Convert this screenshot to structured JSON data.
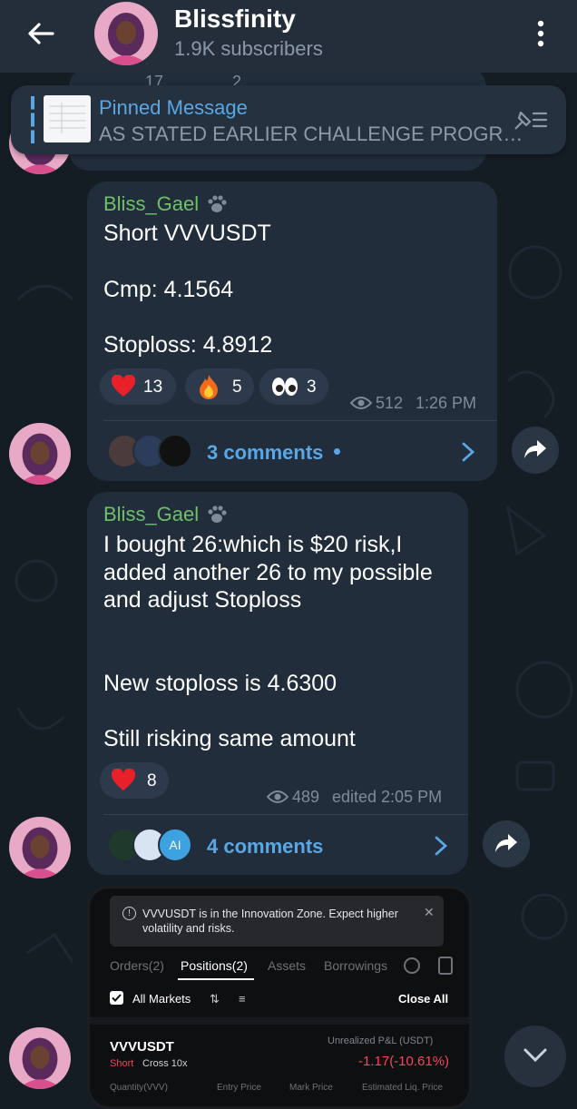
{
  "header": {
    "title": "Blissfinity",
    "subtitle": "1.9K subscribers"
  },
  "pinned": {
    "title": "Pinned Message",
    "text": "AS STATED EARLIER CHALLENGE PROGR…"
  },
  "above": {
    "reaction_counts": [
      "17",
      "2"
    ]
  },
  "messages": [
    {
      "author": "Bliss_Gael",
      "lines": [
        "Short VVVUSDT",
        "Cmp: 4.1564",
        "Stoploss: 4.8912"
      ],
      "reactions": [
        {
          "emoji": "heart",
          "count": "13"
        },
        {
          "emoji": "fire",
          "count": "5"
        },
        {
          "emoji": "eyes",
          "count": "3"
        }
      ],
      "views": "512",
      "time": "1:26 PM",
      "comments": "3 comments"
    },
    {
      "author": "Bliss_Gael",
      "lines": [
        "I bought 26:which is $20 risk,I",
        "added another 26 to my possible",
        "and adjust Stoploss",
        "New stoploss is 4.6300",
        "Still risking same amount"
      ],
      "reactions": [
        {
          "emoji": "heart",
          "count": "8"
        }
      ],
      "views": "489",
      "time": "edited 2:05 PM",
      "comments": "4 comments",
      "commenter_initials": "AI"
    }
  ],
  "screenshot": {
    "notice": "VVVUSDT is in the Innovation Zone. Expect higher volatility and risks.",
    "tabs": [
      "Orders(2)",
      "Positions(2)",
      "Assets",
      "Borrowings"
    ],
    "all_markets": "All Markets",
    "close_all": "Close All",
    "symbol": "VVVUSDT",
    "side": "Short",
    "margin": "Cross 10x",
    "pnl_label": "Unrealized P&L (USDT)",
    "pnl_value": "-1.17(-10.61%)",
    "footer": [
      "Quantity(VVV)",
      "Entry Price",
      "Mark Price",
      "Estimated Liq. Price"
    ]
  },
  "colors": {
    "accent": "#5aa7e6",
    "author": "#6ec06a",
    "bubble": "#212d3b",
    "loss": "#f6465d"
  }
}
